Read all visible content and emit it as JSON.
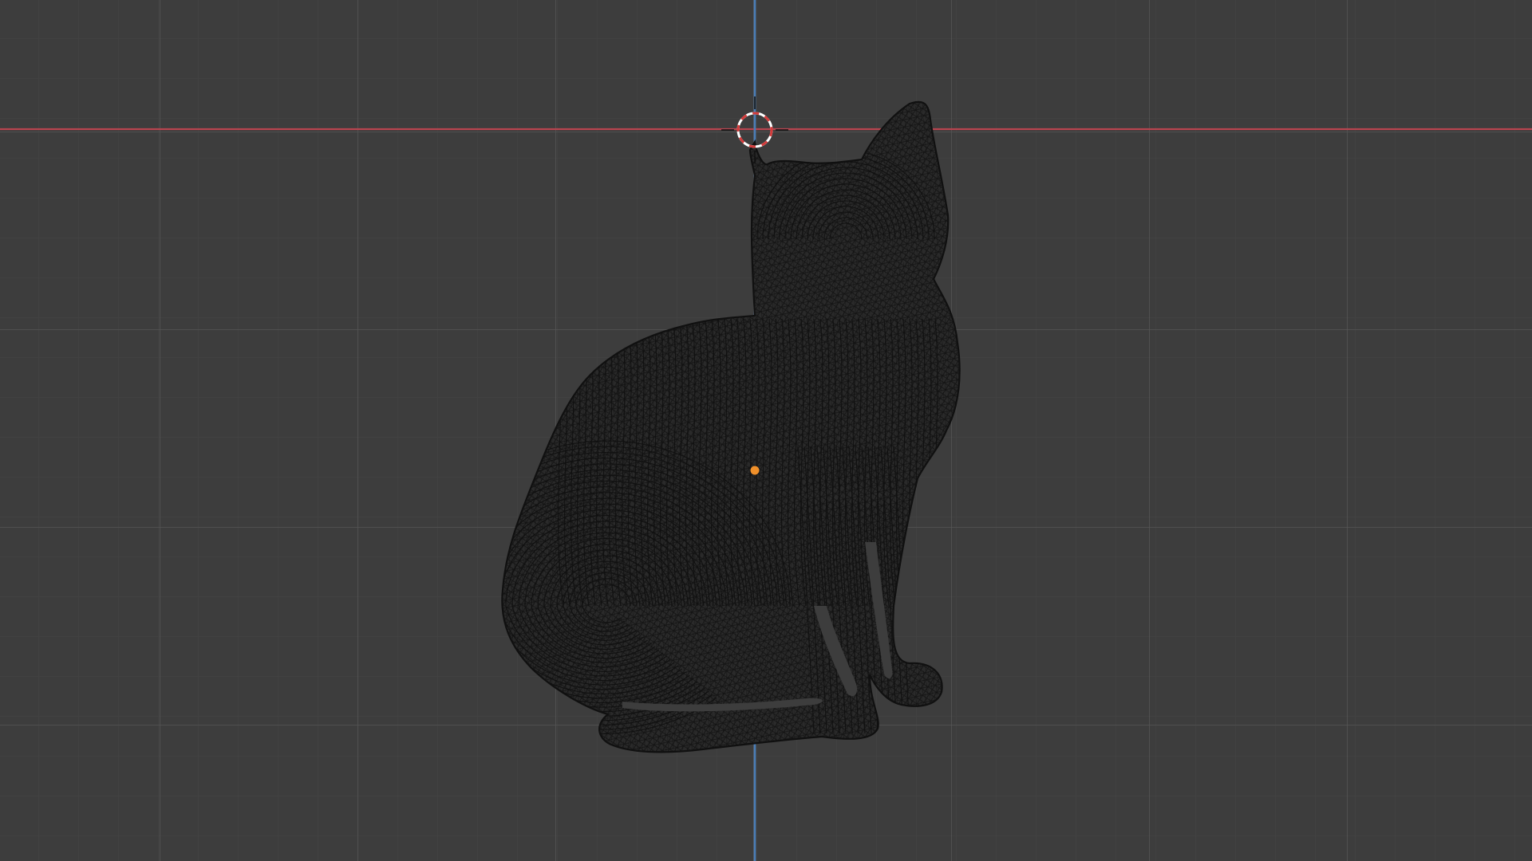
{
  "app": "3D viewport",
  "viewport": {
    "background_color": "#3d3d3d",
    "minor_grid_color": "#454545",
    "major_grid_color": "#555555",
    "x_axis_color": "#b8444f",
    "z_axis_color": "#4a7eb8"
  },
  "object": {
    "name_icon": "cat-wireframe-mesh",
    "shading": "wireframe",
    "wire_color": "#101010",
    "selected": false,
    "origin_color": "#f0902a"
  },
  "cursor": {
    "icon": "3d-cursor-icon",
    "ring_colors": [
      "#d43b3b",
      "#ffffff"
    ]
  }
}
